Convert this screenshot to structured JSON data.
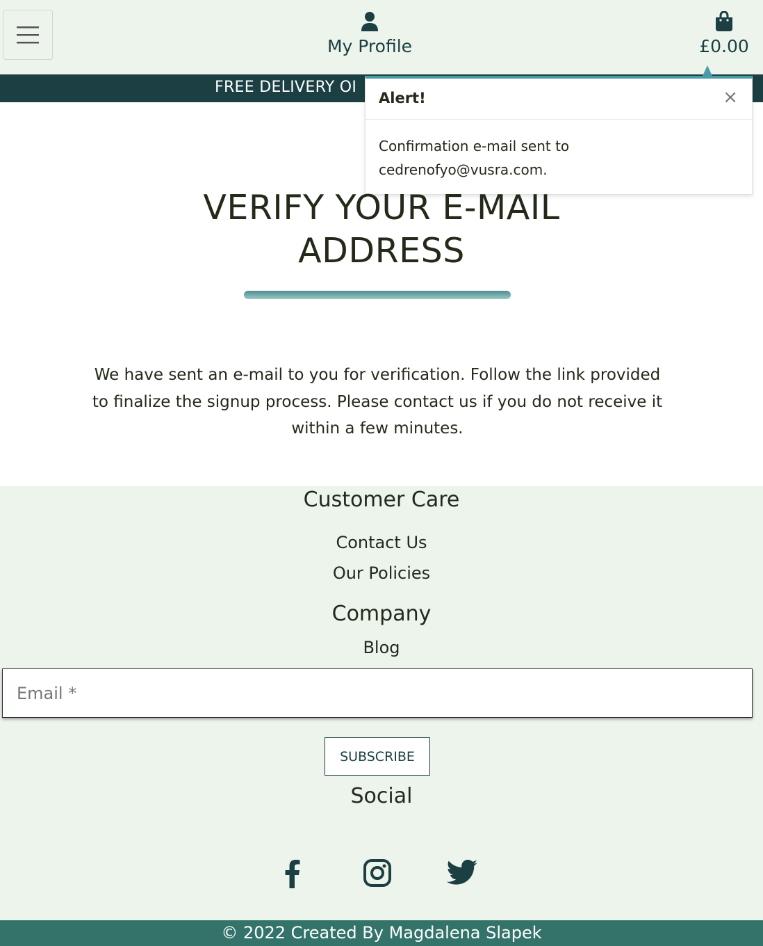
{
  "header": {
    "menu_icon": "hamburger-icon",
    "profile_label": "My Profile",
    "profile_icon": "user-icon",
    "bag_total": "£0.00",
    "bag_icon": "shopping-bag-icon"
  },
  "banner": {
    "text": "FREE DELIVERY OI"
  },
  "alert": {
    "title": "Alert!",
    "close_label": "×",
    "message": "Confirmation e-mail sent to cedrenofyo@vusra.com."
  },
  "main": {
    "title_line1": "VERIFY YOUR E-MAIL",
    "title_line2": "ADDRESS",
    "intro": "We have sent an e-mail to you for verification. Follow the link provided to finalize the signup process. Please contact us if you do not receive it within a few minutes."
  },
  "footer": {
    "customer_care_heading": "Customer Care",
    "contact_us": "Contact Us",
    "our_policies": "Our Policies",
    "company_heading": "Company",
    "blog": "Blog",
    "email_placeholder": "Email *",
    "subscribe_label": "SUBSCRIBE",
    "social_heading": "Social",
    "social_icons": [
      "facebook-icon",
      "instagram-icon",
      "twitter-icon"
    ],
    "copyright": "© 2022 Created By Magdalena Slapek"
  },
  "colors": {
    "header_bg": "#edf4ec",
    "banner_bg": "#1b3f43",
    "accent": "#4a9cab",
    "copyright_bg": "#337369",
    "text": "#232a1a"
  }
}
